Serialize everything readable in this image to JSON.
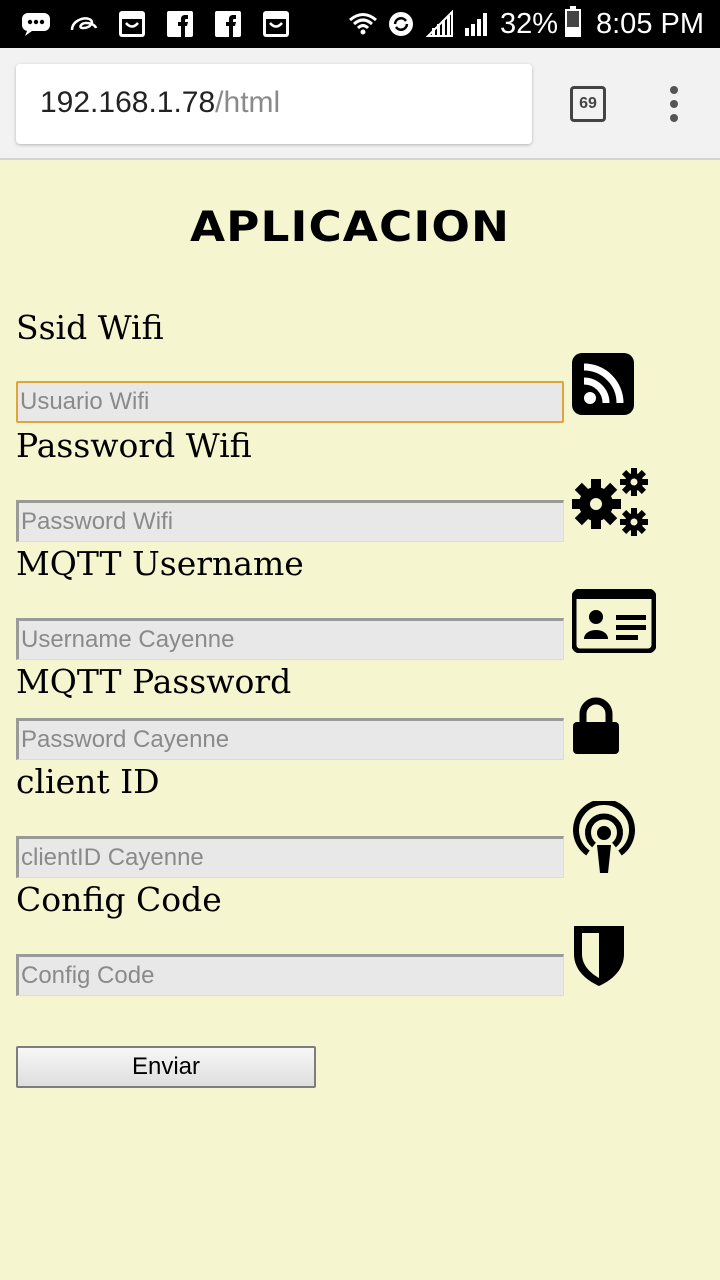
{
  "status_bar": {
    "icons_left": [
      "messages-icon",
      "alibaba-icon",
      "shopping-bag-icon",
      "facebook-icon",
      "facebook-icon",
      "shopping-bag-icon"
    ],
    "icons_right": [
      "wifi-icon",
      "sync-icon",
      "signal-icon",
      "signal-icon"
    ],
    "battery_percent": "32%",
    "time": "8:05 PM"
  },
  "browser": {
    "url_host": "192.168.1.78",
    "url_path": "/html",
    "tab_count": "69",
    "menu_icon": "more-vert-icon"
  },
  "page": {
    "title": "APLICACION",
    "fields": [
      {
        "label": "Ssid Wifi",
        "placeholder": "Usuario Wifi",
        "value": "",
        "icon": "rss-icon",
        "focused": true
      },
      {
        "label": "Password Wifi",
        "placeholder": "Password Wifi",
        "value": "",
        "icon": "gears-icon"
      },
      {
        "label": "MQTT Username",
        "placeholder": "Username Cayenne",
        "value": "",
        "icon": "id-card-icon"
      },
      {
        "label": "MQTT Password",
        "placeholder": "Password Cayenne",
        "value": "",
        "icon": "lock-icon"
      },
      {
        "label": "client ID",
        "placeholder": "clientID Cayenne",
        "value": "",
        "icon": "podcast-icon"
      },
      {
        "label": "Config Code",
        "placeholder": "Config Code",
        "value": "",
        "icon": "shield-icon"
      }
    ],
    "submit_label": "Enviar"
  },
  "colors": {
    "page_background": "#f5f5d0",
    "input_background": "#e8e8e8",
    "focus_border": "#e0a43a",
    "status_bar": "#000000",
    "browser_bar": "#f2f2f2"
  }
}
